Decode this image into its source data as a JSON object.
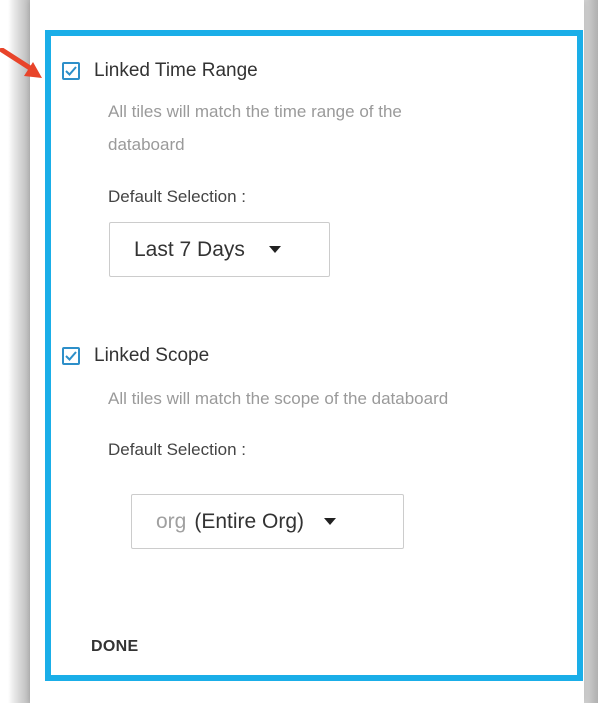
{
  "time_range": {
    "checkbox_label": "Linked Time Range",
    "checked": true,
    "description_line1": "All tiles will match the time range of the",
    "description_line2": "databoard",
    "default_label": "Default Selection :",
    "dropdown_value": "Last 7 Days"
  },
  "scope": {
    "checkbox_label": "Linked Scope",
    "checked": true,
    "description": "All tiles will match the scope of the databoard",
    "default_label": "Default Selection :",
    "dropdown_prefix": "org",
    "dropdown_value": "(Entire Org)"
  },
  "actions": {
    "done_label": "DONE"
  },
  "colors": {
    "highlight": "#1aaee8",
    "checkbox": "#2d8fc9",
    "arrow": "#e8442a"
  },
  "icons": {
    "checkbox_icon": "checkmark-icon",
    "dropdown_icon": "caret-down-icon",
    "pointer_icon": "red-arrow-icon"
  }
}
